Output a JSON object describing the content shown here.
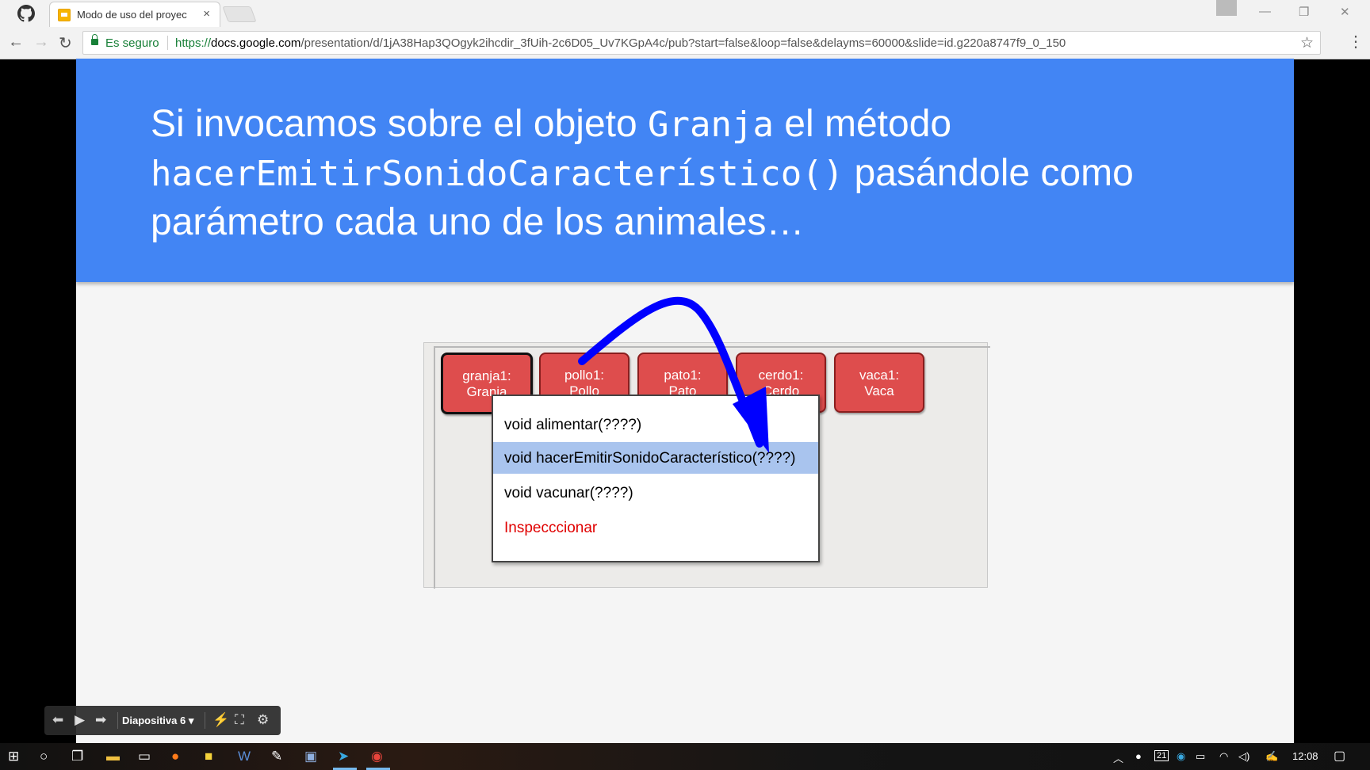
{
  "browser": {
    "tab_title": "Modo de uso del proyec",
    "tab_close": "×",
    "security_label": "Es seguro",
    "url_scheme": "https://",
    "url_host": "docs.google.com",
    "url_path": "/presentation/d/1jA38Hap3QOgyk2ihcdir_3fUih-2c6D05_Uv7KGpA4c/pub?start=false&loop=false&delayms=60000&slide=id.g220a8747f9_0_150"
  },
  "slide": {
    "title_part1": "Si invocamos sobre el objeto ",
    "title_code1": "Granja",
    "title_part2": " el método",
    "title_code2": "hacerEmitirSonidoCaracterístico()",
    "title_part3": " pasándole como",
    "title_line3": "parámetro cada uno de los animales…",
    "objects": [
      {
        "name": "granja1:",
        "type": "Granja"
      },
      {
        "name": "pollo1:",
        "type": "Pollo"
      },
      {
        "name": "pato1:",
        "type": "Pato"
      },
      {
        "name": "cerdo1:",
        "type": "Cerdo"
      },
      {
        "name": "vaca1:",
        "type": "Vaca"
      }
    ],
    "menu": [
      "void alimentar(????)",
      "void hacerEmitirSonidoCaracterístico(????)",
      "void vacunar(????)",
      "Inspecccionar"
    ],
    "arrow_color": "#0000ff"
  },
  "presenter": {
    "slide_label": "Diapositiva 6"
  },
  "taskbar": {
    "date_badge": "21",
    "time": "12:08"
  }
}
